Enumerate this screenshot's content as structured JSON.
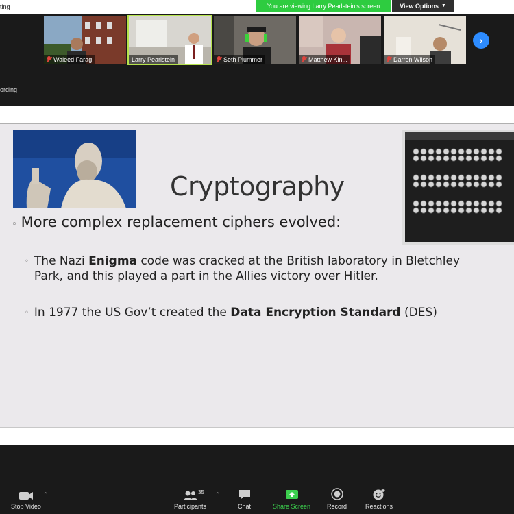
{
  "window": {
    "title_fragment": "ting",
    "recording_fragment": "ording"
  },
  "banner": {
    "viewing_text": "You are viewing Larry Pearlstein's screen",
    "view_options_label": "View Options",
    "colors": {
      "banner_green": "#2ecc40",
      "active_tile_border": "#b6e34d",
      "next_blue": "#2d8cff"
    }
  },
  "participants": [
    {
      "name": "Waleed Farag",
      "muted": true
    },
    {
      "name": "Larry Pearlstein",
      "muted": false,
      "active": true
    },
    {
      "name": "Seth Plummer",
      "muted": true
    },
    {
      "name": "Matthew Kin...",
      "muted": true
    },
    {
      "name": "Darren Wilson",
      "muted": true
    }
  ],
  "slide": {
    "title": "Cryptography",
    "bullet_main": "More complex replacement ciphers evolved:",
    "sub1": {
      "pre": "The Nazi ",
      "bold": "Enigma",
      "post": " code was cracked at the British laboratory in Bletchley Park, and this played a part in the Allies victory over Hitler."
    },
    "sub2": {
      "pre": "In 1977 the US Gov’t created the ",
      "bold": "Data Encryption Standard",
      "post": " (DES)"
    }
  },
  "toolbar": {
    "stop_video": "Stop Video",
    "participants": "Participants",
    "participants_count": "35",
    "chat": "Chat",
    "share_screen": "Share Screen",
    "record": "Record",
    "reactions": "Reactions"
  }
}
